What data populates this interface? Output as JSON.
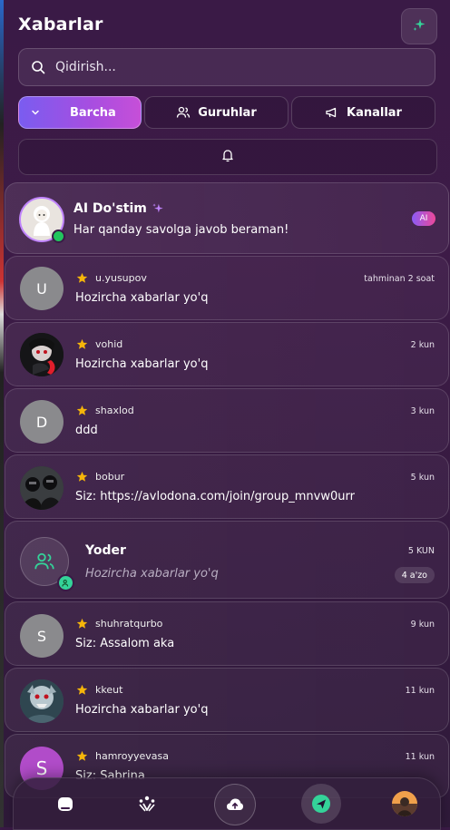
{
  "header": {
    "title": "Xabarlar",
    "sparkle_icon": "sparkles-icon"
  },
  "search": {
    "placeholder": "Qidirish..."
  },
  "filters": {
    "all": "Barcha",
    "groups": "Guruhlar",
    "channels": "Kanallar"
  },
  "colors": {
    "accent": "#a84ee0",
    "online": "#22c55e",
    "star": "#f5b50a",
    "group_green": "#34d399"
  },
  "ai_chat": {
    "name": "AI Do'stim",
    "message": "Har qanday savolga javob beraman!",
    "badge": "AI"
  },
  "chats": [
    {
      "name": "u.yusupov",
      "time": "tahminan 2 soat",
      "message": "Hozircha xabarlar yo'q",
      "avatar_letter": "U"
    },
    {
      "name": "vohid",
      "time": "2 kun",
      "message": "Hozircha xabarlar yo'q"
    },
    {
      "name": "shaxlod",
      "time": "3 kun",
      "message": "ddd",
      "avatar_letter": "D"
    },
    {
      "name": "bobur",
      "time": "5 kun",
      "message": "Siz: https://avlodona.com/join/group_mnvw0urr"
    }
  ],
  "group": {
    "name": "Yoder",
    "time": "5 KUN",
    "message": "Hozircha xabarlar yo'q",
    "members": "4 a'zo"
  },
  "chats2": [
    {
      "name": "shuhratqurbo",
      "time": "9 kun",
      "message": "Siz: Assalom aka",
      "avatar_letter": "S"
    },
    {
      "name": "kkeut",
      "time": "11 kun",
      "message": "Hozircha xabarlar yo'q"
    },
    {
      "name": "hamroyyevasa",
      "time": "11 kun",
      "message": "Siz: Sabrina",
      "avatar_letter": "S"
    }
  ]
}
